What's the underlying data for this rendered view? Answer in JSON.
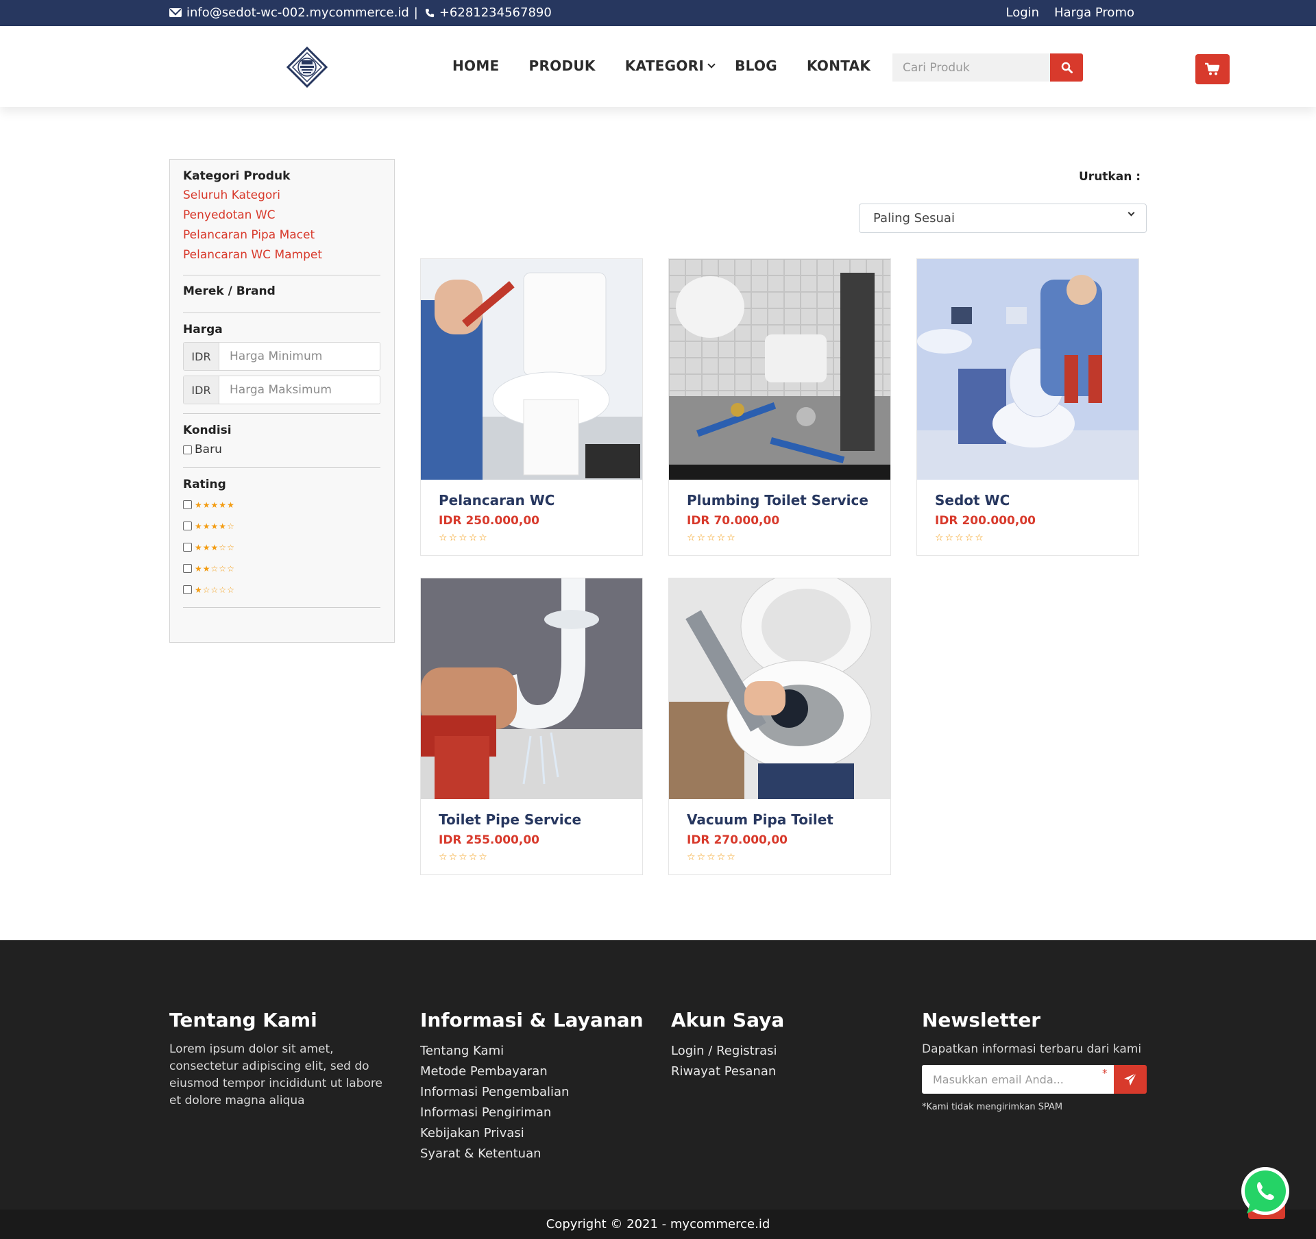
{
  "topbar": {
    "email": "info@sedot-wc-002.mycommerce.id",
    "separator": "|",
    "phone": "+6281234567890",
    "login": "Login",
    "promo": "Harga Promo"
  },
  "nav": {
    "items": [
      "HOME",
      "PRODUK",
      "KATEGORI",
      "BLOG",
      "KONTAK"
    ]
  },
  "search": {
    "placeholder": "Cari Produk"
  },
  "sidebar": {
    "category_title": "Kategori Produk",
    "categories": [
      "Seluruh Kategori",
      "Penyedotan WC",
      "Pelancaran Pipa Macet",
      "Pelancaran WC Mampet"
    ],
    "brand_title": "Merek / Brand",
    "price_title": "Harga",
    "currency": "IDR",
    "min_placeholder": "Harga Minimum",
    "max_placeholder": "Harga Maksimum",
    "condition_title": "Kondisi",
    "condition_new": "Baru",
    "rating_title": "Rating",
    "rating_options": [
      5,
      4,
      3,
      2,
      1
    ]
  },
  "sort": {
    "label": "Urutkan :",
    "selected": "Paling Sesuai"
  },
  "products": [
    {
      "name": "Pelancaran WC",
      "price": "IDR 250.000,00",
      "rating": 0
    },
    {
      "name": "Plumbing Toilet Service",
      "price": "IDR 70.000,00",
      "rating": 0
    },
    {
      "name": "Sedot WC",
      "price": "IDR 200.000,00",
      "rating": 0
    },
    {
      "name": "Toilet Pipe Service",
      "price": "IDR 255.000,00",
      "rating": 0
    },
    {
      "name": "Vacuum Pipa Toilet",
      "price": "IDR 270.000,00",
      "rating": 0
    }
  ],
  "footer": {
    "about_title": "Tentang Kami",
    "about_text": "Lorem ipsum dolor sit amet, consectetur adipiscing elit, sed do eiusmod tempor incididunt ut labore et dolore magna aliqua",
    "info_title": "Informasi & Layanan",
    "info_links": [
      "Tentang Kami",
      "Metode Pembayaran",
      "Informasi Pengembalian",
      "Informasi Pengiriman",
      "Kebijakan Privasi",
      "Syarat & Ketentuan"
    ],
    "account_title": "Akun Saya",
    "account_links": [
      "Login / Registrasi",
      "Riwayat Pesanan"
    ],
    "newsletter_title": "Newsletter",
    "newsletter_text": "Dapatkan informasi terbaru dari kami",
    "newsletter_placeholder": "Masukkan email Anda...",
    "newsletter_required": "*",
    "newsletter_note": "*Kami tidak mengirimkan SPAM"
  },
  "copyright": "Copyright © 2021 - mycommerce.id",
  "colors": {
    "navy": "#27375f",
    "accent_red": "#d83a2c",
    "star": "#f39c12",
    "footer_bg": "#212121"
  },
  "icons": [
    "envelope-icon",
    "phone-icon",
    "search-icon",
    "cart-icon",
    "chevron-down-icon",
    "star-icon",
    "send-icon",
    "whatsapp-icon"
  ]
}
